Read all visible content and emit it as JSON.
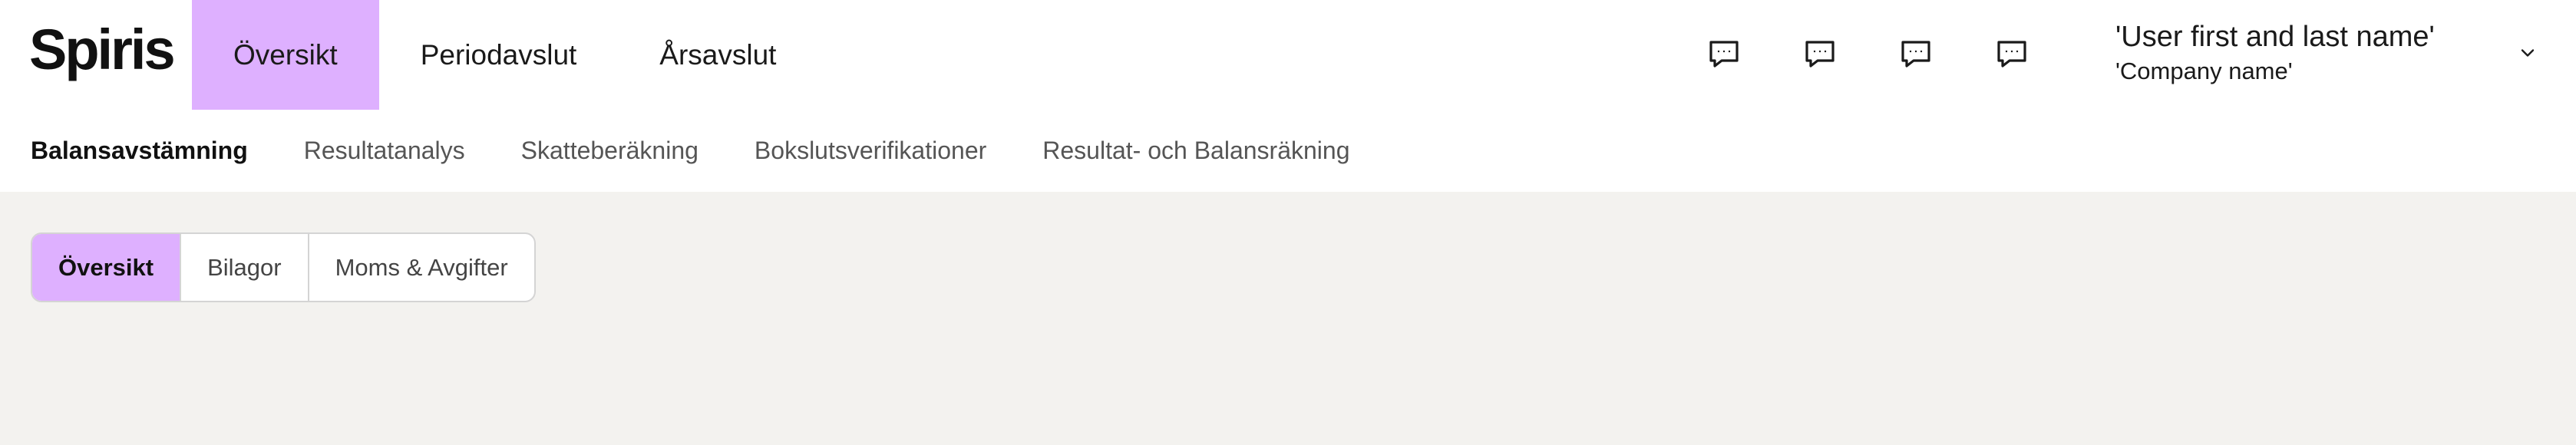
{
  "app": {
    "logo_text": "Spiris"
  },
  "main_nav": {
    "tabs": [
      {
        "label": "Översikt",
        "active": true
      },
      {
        "label": "Periodavslut",
        "active": false
      },
      {
        "label": "Årsavslut",
        "active": false
      }
    ]
  },
  "header_icons": [
    {
      "icon": "chat-bubble-icon"
    },
    {
      "icon": "chat-bubble-icon"
    },
    {
      "icon": "chat-bubble-icon"
    },
    {
      "icon": "chat-bubble-icon"
    }
  ],
  "user": {
    "name": "'User first and last name'",
    "company": "'Company name'",
    "menu_icon": "chevron-down-icon"
  },
  "sub_nav": {
    "tabs": [
      {
        "label": "Balansavstämning",
        "active": true
      },
      {
        "label": "Resultatanalys",
        "active": false
      },
      {
        "label": "Skatteberäkning",
        "active": false
      },
      {
        "label": "Bokslutsverifikationer",
        "active": false
      },
      {
        "label": "Resultat- och Balansräkning",
        "active": false
      }
    ]
  },
  "segmented_control": {
    "options": [
      {
        "label": "Översikt",
        "active": true
      },
      {
        "label": "Bilagor",
        "active": false
      },
      {
        "label": "Moms & Avgifter",
        "active": false
      }
    ]
  },
  "colors": {
    "accent": "#deb0ff",
    "header_bg": "#ffffff",
    "content_bg": "#f3f2ef"
  }
}
